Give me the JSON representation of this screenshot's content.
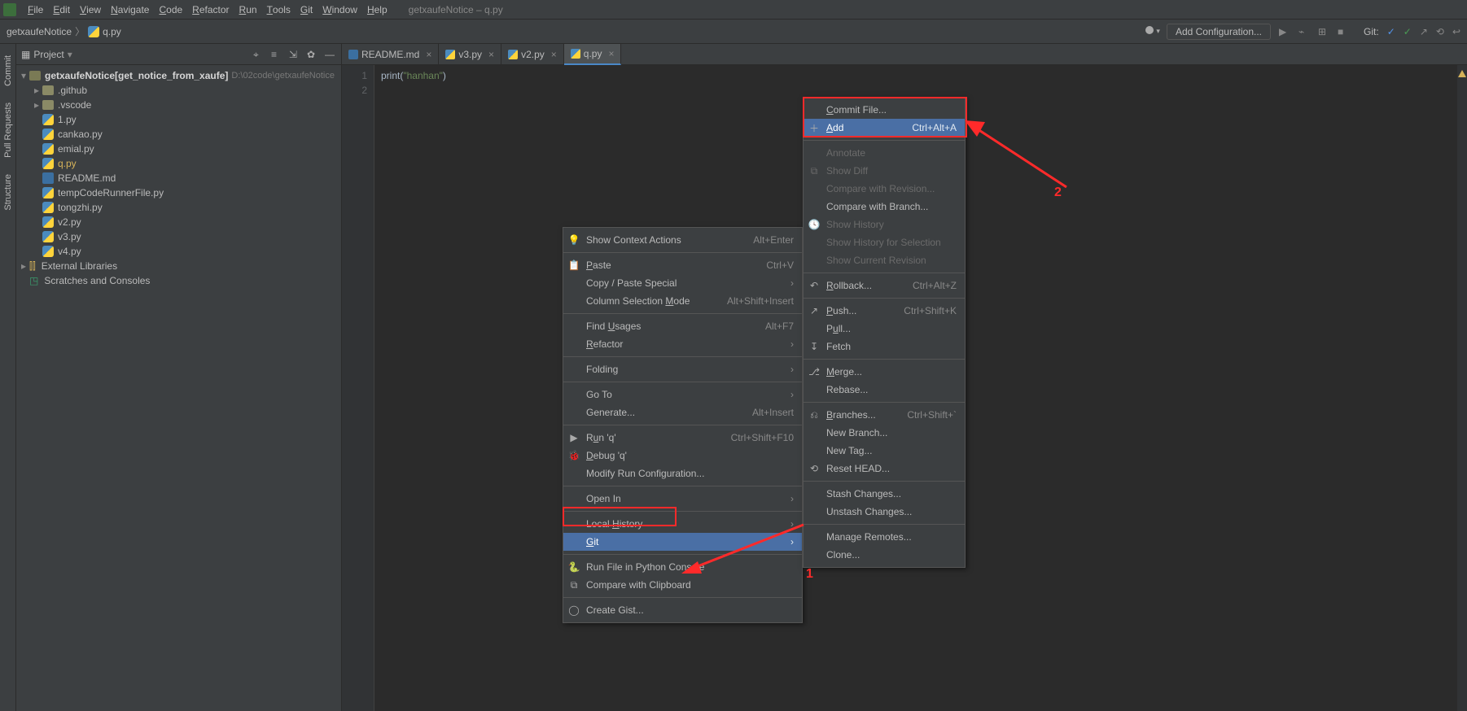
{
  "menubar": {
    "items": [
      "File",
      "Edit",
      "View",
      "Navigate",
      "Code",
      "Refactor",
      "Run",
      "Tools",
      "Git",
      "Window",
      "Help"
    ],
    "title": "getxaufeNotice – q.py"
  },
  "breadcrumb": {
    "root": "getxaufeNotice",
    "file": "q.py"
  },
  "nav_right": {
    "add_config": "Add Configuration...",
    "git_label": "Git:"
  },
  "project_panel": {
    "title": "Project",
    "root_name": "getxaufeNotice",
    "root_annot": "[get_notice_from_xaufe]",
    "root_path": "D:\\02code\\getxaufeNotice",
    "folders": [
      ".github",
      ".vscode"
    ],
    "files": [
      "1.py",
      "cankao.py",
      "emial.py",
      "q.py",
      "README.md",
      "tempCodeRunnerFile.py",
      "tongzhi.py",
      "v2.py",
      "v3.py",
      "v4.py"
    ],
    "selected_file": "q.py",
    "external_libs": "External Libraries",
    "scratches": "Scratches and Consoles"
  },
  "tabs": [
    {
      "label": "README.md",
      "type": "md"
    },
    {
      "label": "v3.py",
      "type": "py"
    },
    {
      "label": "v2.py",
      "type": "py"
    },
    {
      "label": "q.py",
      "type": "py",
      "active": true
    }
  ],
  "editor": {
    "lines": [
      "1",
      "2"
    ],
    "code_1": "print",
    "code_1_str": "\"hanhan\"",
    "code_1_open": "(",
    "code_1_close": ")"
  },
  "context_menu_1": {
    "items": [
      {
        "icon": "bulb",
        "label": "Show Context Actions",
        "shortcut": "Alt+Enter"
      },
      {
        "sep": true
      },
      {
        "icon": "paste",
        "label": "Paste",
        "shortcut": "Ctrl+V",
        "u": "P"
      },
      {
        "label": "Copy / Paste Special",
        "sub": "›"
      },
      {
        "label": "Column Selection Mode",
        "shortcut": "Alt+Shift+Insert",
        "u": "M"
      },
      {
        "sep": true
      },
      {
        "label": "Find Usages",
        "shortcut": "Alt+F7",
        "u": "U"
      },
      {
        "label": "Refactor",
        "sub": "›",
        "u": "R"
      },
      {
        "sep": true
      },
      {
        "label": "Folding",
        "sub": "›"
      },
      {
        "sep": true
      },
      {
        "label": "Go To",
        "sub": "›"
      },
      {
        "label": "Generate...",
        "shortcut": "Alt+Insert"
      },
      {
        "sep": true
      },
      {
        "icon": "run",
        "label": "Run 'q'",
        "shortcut": "Ctrl+Shift+F10",
        "u": "u"
      },
      {
        "icon": "debug",
        "label": "Debug 'q'",
        "u": "D"
      },
      {
        "label": "Modify Run Configuration..."
      },
      {
        "sep": true
      },
      {
        "label": "Open In",
        "sub": "›"
      },
      {
        "sep": true
      },
      {
        "label": "Local History",
        "sub": "›",
        "u": "H"
      },
      {
        "label": "Git",
        "sub": "›",
        "selected": true,
        "u": "G"
      },
      {
        "sep": true
      },
      {
        "icon": "pyconsole",
        "label": "Run File in Python Console"
      },
      {
        "icon": "diff",
        "label": "Compare with Clipboard"
      },
      {
        "sep": true
      },
      {
        "icon": "github",
        "label": "Create Gist..."
      }
    ]
  },
  "context_menu_2": {
    "items": [
      {
        "label": "Commit File...",
        "disabled_edge": true,
        "u": "C"
      },
      {
        "icon": "plus",
        "label": "Add",
        "shortcut": "Ctrl+Alt+A",
        "selected": true,
        "u": "A"
      },
      {
        "sep": true
      },
      {
        "label": "Annotate",
        "disabled": true
      },
      {
        "icon": "diff",
        "label": "Show Diff",
        "disabled": true
      },
      {
        "label": "Compare with Revision...",
        "disabled": true
      },
      {
        "label": "Compare with Branch..."
      },
      {
        "icon": "history",
        "label": "Show History",
        "disabled": true
      },
      {
        "label": "Show History for Selection",
        "disabled": true
      },
      {
        "label": "Show Current Revision",
        "disabled": true
      },
      {
        "sep": true
      },
      {
        "icon": "rollback",
        "label": "Rollback...",
        "shortcut": "Ctrl+Alt+Z",
        "u": "R"
      },
      {
        "sep": true
      },
      {
        "icon": "push",
        "label": "Push...",
        "shortcut": "Ctrl+Shift+K",
        "u": "P"
      },
      {
        "label": "Pull...",
        "u": "u"
      },
      {
        "icon": "fetch",
        "label": "Fetch"
      },
      {
        "sep": true
      },
      {
        "icon": "merge",
        "label": "Merge...",
        "u": "M"
      },
      {
        "label": "Rebase..."
      },
      {
        "sep": true
      },
      {
        "icon": "branch",
        "label": "Branches...",
        "shortcut": "Ctrl+Shift+`",
        "u": "B"
      },
      {
        "label": "New Branch..."
      },
      {
        "label": "New Tag..."
      },
      {
        "icon": "reset",
        "label": "Reset HEAD..."
      },
      {
        "sep": true
      },
      {
        "label": "Stash Changes..."
      },
      {
        "label": "Unstash Changes..."
      },
      {
        "sep": true
      },
      {
        "label": "Manage Remotes..."
      },
      {
        "label": "Clone..."
      }
    ]
  },
  "annotations": {
    "box1_label": "1",
    "box2_label": "2"
  },
  "left_tabs": [
    "Commit",
    "Pull Requests",
    "Structure"
  ]
}
